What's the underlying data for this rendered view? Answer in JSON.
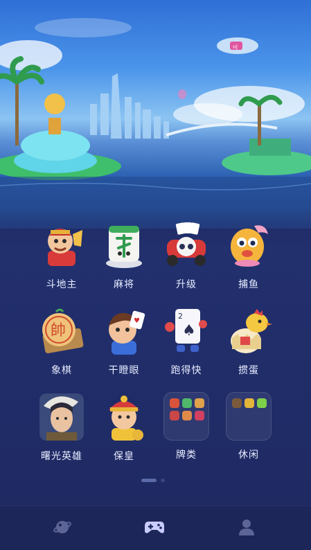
{
  "games": [
    {
      "label": "斗地主",
      "icon": "landlord-character-icon"
    },
    {
      "label": "麻将",
      "icon": "mahjong-tile-icon"
    },
    {
      "label": "升级",
      "icon": "robot-car-cards-icon"
    },
    {
      "label": "捕鱼",
      "icon": "goldfish-icon"
    },
    {
      "label": "象棋",
      "icon": "chess-piece-icon"
    },
    {
      "label": "干瞪眼",
      "icon": "boy-card-icon"
    },
    {
      "label": "跑得快",
      "icon": "running-card-icon"
    },
    {
      "label": "掼蛋",
      "icon": "chicken-egg-icon"
    },
    {
      "label": "曙光英雄",
      "icon": "hero-character-icon"
    },
    {
      "label": "保皇",
      "icon": "emperor-character-icon"
    },
    {
      "label": "牌类",
      "icon": "card-games-folder-icon"
    },
    {
      "label": "休闲",
      "icon": "casual-games-folder-icon"
    }
  ],
  "hero": {
    "blimp_text": "ıı|"
  },
  "pager": {
    "pages": 2,
    "active": 1
  },
  "tabs": [
    {
      "name": "planet",
      "icon": "planet-icon"
    },
    {
      "name": "games",
      "icon": "gamepad-icon",
      "active": true
    },
    {
      "name": "profile",
      "icon": "person-icon"
    }
  ],
  "colors": {
    "tab_active": "#c9ccff",
    "tab_inactive": "#5c6596",
    "label": "#e8ecff"
  }
}
